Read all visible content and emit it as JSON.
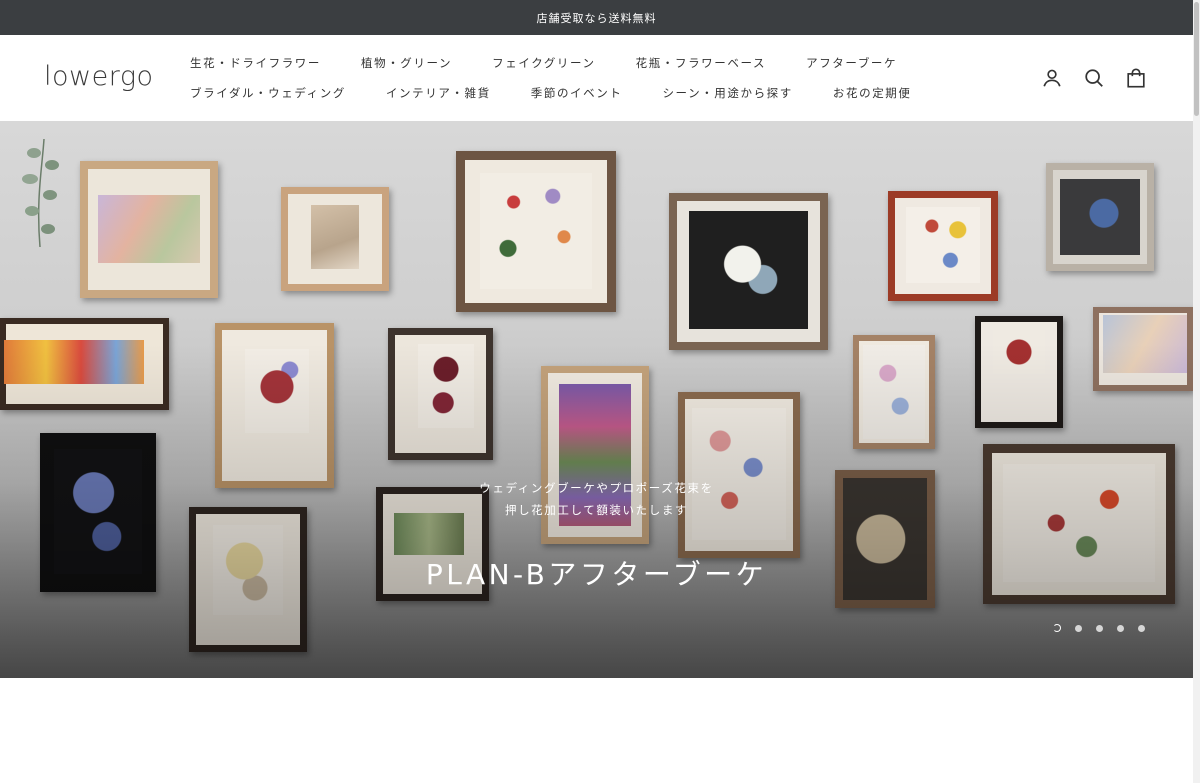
{
  "announcement": {
    "text": "店舗受取なら送料無料"
  },
  "header": {
    "logo": "lowergo",
    "nav_row1": [
      "生花・ドライフラワー",
      "植物・グリーン",
      "フェイクグリーン",
      "花瓶・フラワーベース",
      "アフターブーケ"
    ],
    "nav_row2": [
      "ブライダル・ウェディング",
      "インテリア・雑貨",
      "季節のイベント",
      "シーン・用途から探す",
      "お花の定期便"
    ],
    "icons": [
      "account-icon",
      "search-icon",
      "cart-icon"
    ]
  },
  "hero": {
    "subtitle_line1": "ウェディングブーケやプロポーズ花束を",
    "subtitle_line2": "押し花加工して額装いたします",
    "title": "PLAN-Bアフターブーケ",
    "slide_count": 5,
    "active_slide": 1
  },
  "colors": {
    "announcement_bg": "#3b3e41",
    "wall": "#cfcfcf",
    "text": "#2b2b2b"
  }
}
